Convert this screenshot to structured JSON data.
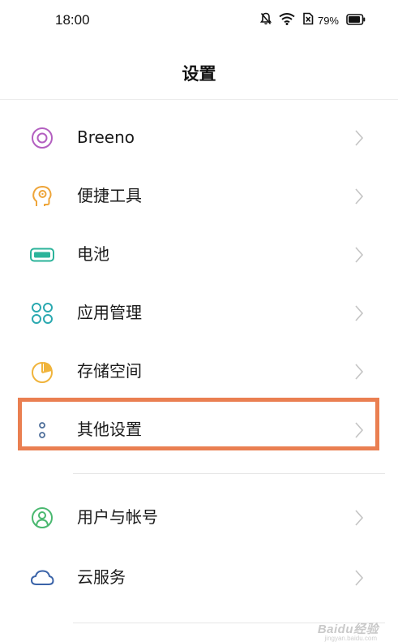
{
  "status_bar": {
    "time": "18:00",
    "battery_percent": "79%",
    "icons": [
      "mute-bell-icon",
      "wifi-icon",
      "sim-off-icon",
      "battery-icon"
    ]
  },
  "header": {
    "title": "设置"
  },
  "settings": {
    "items": [
      {
        "label": "Breeno",
        "icon": "breeno-icon",
        "color": "#b35fc0"
      },
      {
        "label": "便捷工具",
        "icon": "convenience-tools-icon",
        "color": "#eea53a"
      },
      {
        "label": "电池",
        "icon": "battery-icon",
        "color": "#2bb39a"
      },
      {
        "label": "应用管理",
        "icon": "app-management-icon",
        "color": "#2aa9b0"
      },
      {
        "label": "存储空间",
        "icon": "storage-icon",
        "color": "#f0b43c"
      },
      {
        "label": "其他设置",
        "icon": "other-settings-icon",
        "color": "#4e6e9a",
        "highlighted": true
      },
      {
        "label": "用户与帐号",
        "icon": "user-account-icon",
        "color": "#4ab870"
      },
      {
        "label": "云服务",
        "icon": "cloud-icon",
        "color": "#3a63a8"
      }
    ]
  },
  "watermark": {
    "text": "Baidu经验",
    "sub": "jingyan.baidu.com"
  },
  "colors": {
    "highlight_border": "#ea7f51",
    "chevron": "#c4c4c4"
  }
}
